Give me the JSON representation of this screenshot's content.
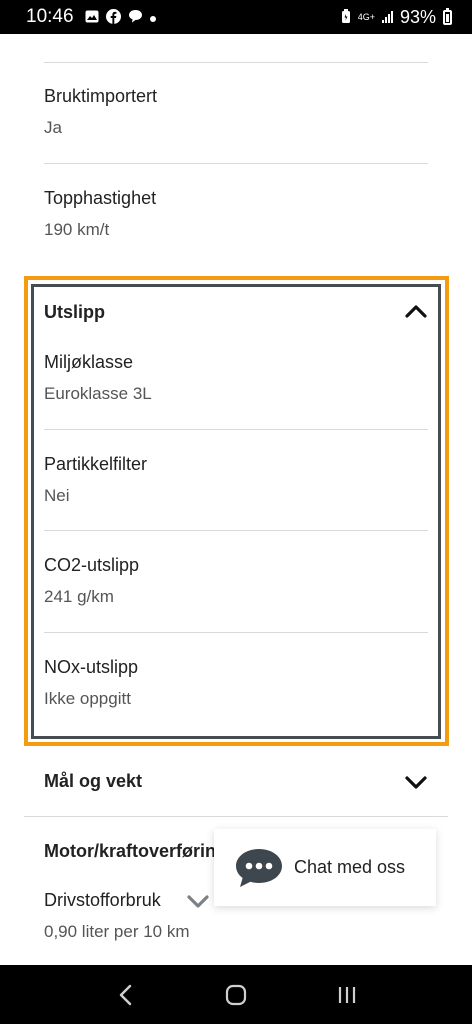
{
  "status_bar": {
    "time": "10:46",
    "network": "4G+",
    "battery": "93%"
  },
  "specs_top": [
    {
      "label": "Bruktimportert",
      "value": "Ja"
    },
    {
      "label": "Topphastighet",
      "value": "190 km/t"
    }
  ],
  "emissions": {
    "title": "Utslipp",
    "items": [
      {
        "label": "Miljøklasse",
        "value": "Euroklasse 3L"
      },
      {
        "label": "Partikkelfilter",
        "value": "Nei"
      },
      {
        "label": "CO2-utslipp",
        "value": "241 g/km"
      },
      {
        "label": "NOx-utslipp",
        "value": "Ikke oppgitt"
      }
    ]
  },
  "dimensions": {
    "title": "Mål og vekt"
  },
  "motor": {
    "title": "Motor/kraftoverføring",
    "items": [
      {
        "label": "Drivstofforbruk",
        "value": "0,90 liter per 10 km"
      }
    ]
  },
  "chat": {
    "label": "Chat med oss"
  },
  "icons": {
    "chevron_up": "chevron-up-icon",
    "chevron_down": "chevron-down-icon",
    "chat": "chat-bubble-icon"
  },
  "colors": {
    "focus_ring": "#f39c12",
    "focus_inner": "#454c52",
    "chat_bubble": "#3f474e"
  }
}
